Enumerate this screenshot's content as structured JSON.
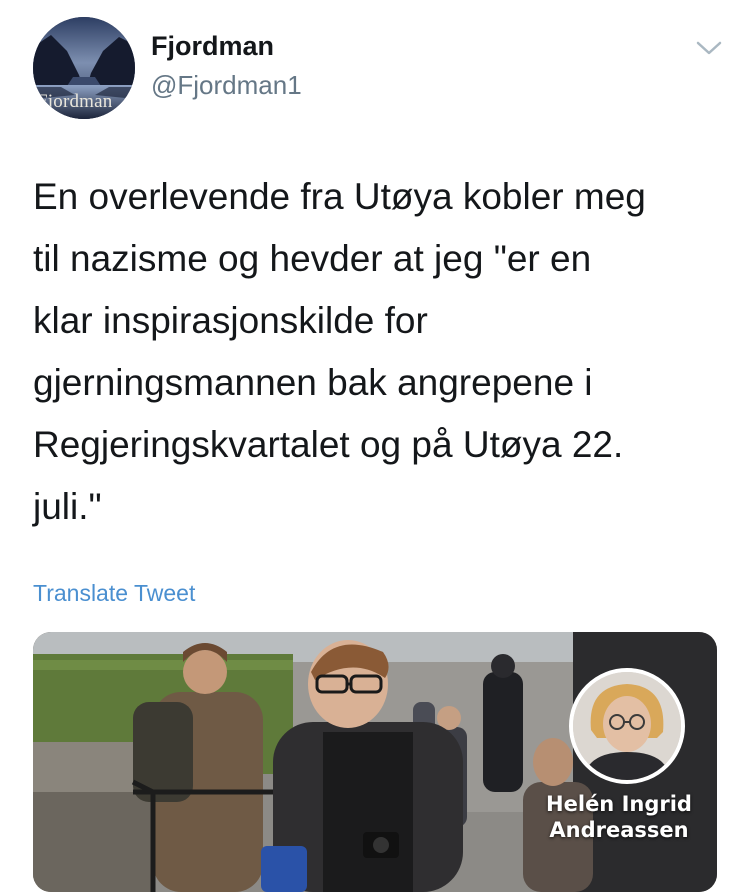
{
  "user": {
    "avatar_text": "Fjordman",
    "display_name": "Fjordman",
    "handle": "@Fjordman1"
  },
  "tweet": {
    "text": "En overlevende fra Utøya kobler meg\ntil nazisme og hevder at jeg \"er en\nklar inspirasjonskilde for\ngjerningsmannen bak angrepene i\nRegjeringskvartalet og på Utøya 22.\njuli.\"",
    "translate_label": "Translate Tweet"
  },
  "media": {
    "caption": "Helén Ingrid\nAndreassen"
  },
  "icons": {
    "caret": "chevron-down-icon"
  },
  "colors": {
    "text": "#14171a",
    "secondary": "#657786",
    "link": "#4a8fd0"
  }
}
